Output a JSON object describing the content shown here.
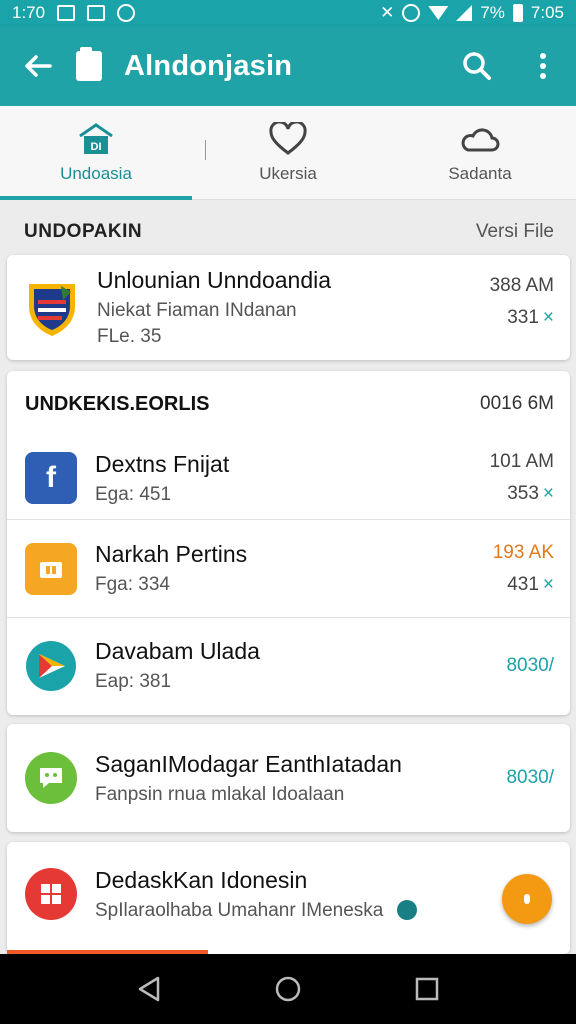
{
  "status_bar": {
    "time_left": "1:70",
    "battery": "7%",
    "time_right": "7:05"
  },
  "app_bar": {
    "title": "Alndonjasin"
  },
  "tabs": [
    {
      "label": "Undoasia",
      "icon": "home-icon",
      "active": true
    },
    {
      "label": "Ukersia",
      "icon": "heart-icon",
      "active": false
    },
    {
      "label": "Sadanta",
      "icon": "cloud-icon",
      "active": false
    }
  ],
  "section": {
    "title": "UNDOPAKIN",
    "right": "Versi File"
  },
  "card1": {
    "name": "Unlounian Unndoandia",
    "sub1": "Niekat Fiaman INdanan",
    "sub2": "FLe. 35",
    "meta1": "388 AM",
    "meta2": "331",
    "mark": "×"
  },
  "card2": {
    "title": "UNDKEKIS.EORLIS",
    "right": "0016 6M",
    "rows": [
      {
        "name": "Dextns Fnijat",
        "sub": "Ega: 451",
        "meta1": "101 AM",
        "meta2": "353",
        "mark": "×",
        "icon": "facebook-icon"
      },
      {
        "name": "Narkah Pertins",
        "sub": "Fga: 334",
        "meta1": "193 AK",
        "meta2": "431",
        "mark": "×",
        "icon": "folder-icon"
      },
      {
        "name": "Davabam Ulada",
        "sub": "Eap: 381",
        "meta1": "8030/",
        "icon": "play-store-icon"
      }
    ]
  },
  "card3": {
    "name": "SaganIModagar EanthIatadan",
    "sub": "Fanpsin rnua mlakal Idoalaan",
    "meta1": "8030/"
  },
  "card4": {
    "name": "DedaskKan Idonesin",
    "sub": "SpIlaraolhaba Umahanr IMeneska"
  },
  "colors": {
    "accent": "#1fa3a7",
    "fab": "#f39a12",
    "facebook": "#2f5fb4",
    "folder": "#f5a623",
    "green": "#6cbf3a",
    "red": "#e53935"
  }
}
